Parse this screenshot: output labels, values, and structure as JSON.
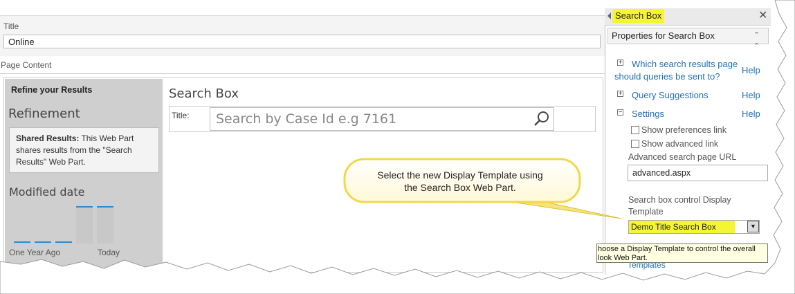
{
  "title_field": {
    "label": "Title",
    "value": "Online"
  },
  "page_content_label": "Page Content",
  "refinement_panel": {
    "header": "Refine your Results",
    "heading": "Refinement",
    "shared_results": {
      "bold": "Shared Results:",
      "text": " This Web Part shares results from the \"Search Results\" Web Part."
    },
    "modified_heading": "Modified date",
    "histogram_levels": [
      0.05,
      0.05,
      0.05,
      1.0,
      1.0
    ],
    "slider_start_label": "One Year Ago",
    "slider_end_label": "Today",
    "accent_color": "#2a8dd4"
  },
  "search_webpart": {
    "title": "Search Box",
    "field_label": "Title:",
    "placeholder": "Search by Case Id e.g 7161",
    "icon": "search-icon"
  },
  "tool_pane": {
    "title": "Search Box",
    "properties_header": "Properties for Search Box",
    "sections": [
      {
        "expander": "+",
        "label": "Which search results page should queries be sent to?",
        "help": "Help"
      },
      {
        "expander": "+",
        "label": "Query Suggestions",
        "help": "Help"
      },
      {
        "expander": "−",
        "label": "Settings",
        "help": "Help"
      }
    ],
    "show_preferences_link": "Show preferences link",
    "show_advanced_link": "Show advanced link",
    "advanced_url_label": "Advanced search page URL",
    "advanced_url_value": "advanced.aspx",
    "display_template_label": "Search box control Display Template",
    "display_template_value": "Demo Title Search Box",
    "tooltip": "hoose a Display Template to control the overall look Web Part.",
    "templates_link": "Templates",
    "highlight_color": "#f5f532"
  },
  "callout": {
    "text_line1": "Select the new Display Template using",
    "text_line2": "the Search Box Web Part."
  }
}
